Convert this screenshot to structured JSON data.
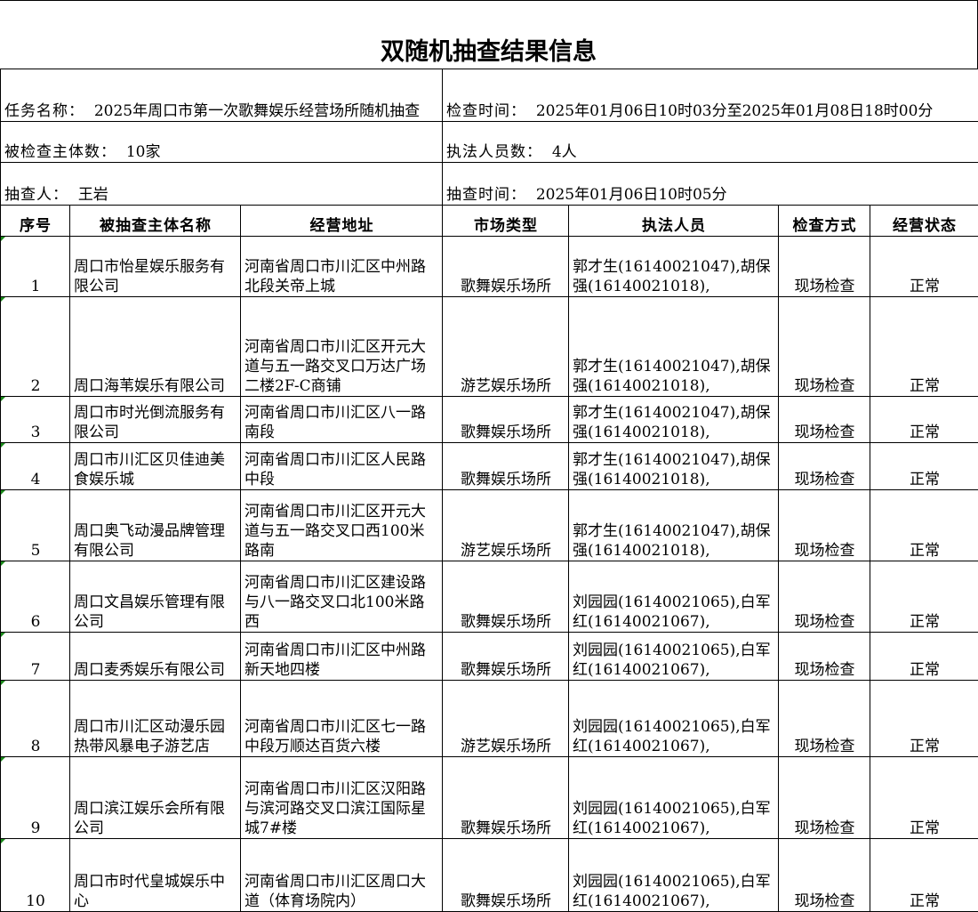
{
  "title": "双随机抽查结果信息",
  "info": {
    "task_label": "任务名称：",
    "task_value": "2025年周口市第一次歌舞娱乐经营场所随机抽查",
    "check_time_label": "检查时间：",
    "check_time_value": "2025年01月06日10时03分至2025年01月08日18时00分",
    "subject_count_label": "被检查主体数：",
    "subject_count_value": "10家",
    "officer_count_label": "执法人员数：",
    "officer_count_value": "4人",
    "checker_label": "抽查人：",
    "checker_value": "王岩",
    "draw_time_label": "抽查时间：",
    "draw_time_value": "2025年01月06日10时05分"
  },
  "columns": [
    "序号",
    "被抽查主体名称",
    "经营地址",
    "市场类型",
    "执法人员",
    "检查方式",
    "经营状态"
  ],
  "rows": [
    {
      "no": "1",
      "name": "周口市怡星娱乐服务有限公司",
      "address": "河南省周口市川汇区中州路北段关帝上城",
      "type": "歌舞娱乐场所",
      "officers": "郭才生(16140021047),胡保强(16140021018),",
      "method": "现场检查",
      "status": "正常"
    },
    {
      "no": "2",
      "name": "周口海苇娱乐有限公司",
      "address": "河南省周口市川汇区开元大道与五一路交叉口万达广场二楼2F-C商铺",
      "type": "游艺娱乐场所",
      "officers": "郭才生(16140021047),胡保强(16140021018),",
      "method": "现场检查",
      "status": "正常"
    },
    {
      "no": "3",
      "name": "周口市时光倒流服务有限公司",
      "address": "河南省周口市川汇区八一路南段",
      "type": "歌舞娱乐场所",
      "officers": "郭才生(16140021047),胡保强(16140021018),",
      "method": "现场检查",
      "status": "正常"
    },
    {
      "no": "4",
      "name": "周口市川汇区贝佳迪美食娱乐城",
      "address": "河南省周口市川汇区人民路中段",
      "type": "歌舞娱乐场所",
      "officers": "郭才生(16140021047),胡保强(16140021018),",
      "method": "现场检查",
      "status": "正常"
    },
    {
      "no": "5",
      "name": "周口奥飞动漫品牌管理有限公司",
      "address": "河南省周口市川汇区开元大道与五一路交叉口西100米路南",
      "type": "游艺娱乐场所",
      "officers": "郭才生(16140021047),胡保强(16140021018),",
      "method": "现场检查",
      "status": "正常"
    },
    {
      "no": "6",
      "name": "周口文昌娱乐管理有限公司",
      "address": "河南省周口市川汇区建设路与八一路交叉口北100米路西",
      "type": "歌舞娱乐场所",
      "officers": "刘园园(16140021065),白军红(16140021067),",
      "method": "现场检查",
      "status": "正常"
    },
    {
      "no": "7",
      "name": "周口麦秀娱乐有限公司",
      "address": "河南省周口市川汇区中州路新天地四楼",
      "type": "歌舞娱乐场所",
      "officers": "刘园园(16140021065),白军红(16140021067),",
      "method": "现场检查",
      "status": "正常"
    },
    {
      "no": "8",
      "name": "周口市川汇区动漫乐园热带风暴电子游艺店",
      "address": "河南省周口市川汇区七一路中段万顺达百货六楼",
      "type": "游艺娱乐场所",
      "officers": "刘园园(16140021065),白军红(16140021067),",
      "method": "现场检查",
      "status": "正常"
    },
    {
      "no": "9",
      "name": "周口滨江娱乐会所有限公司",
      "address": "河南省周口市川汇区汉阳路与滨河路交叉口滨江国际星城7#楼",
      "type": "歌舞娱乐场所",
      "officers": "刘园园(16140021065),白军红(16140021067),",
      "method": "现场检查",
      "status": "正常"
    },
    {
      "no": "10",
      "name": "周口市时代皇城娱乐中心",
      "address": "河南省周口市川汇区周口大道（体育场院内）",
      "type": "歌舞娱乐场所",
      "officers": "刘园园(16140021065),白军红(16140021067),",
      "method": "现场检查",
      "status": "正常"
    }
  ]
}
